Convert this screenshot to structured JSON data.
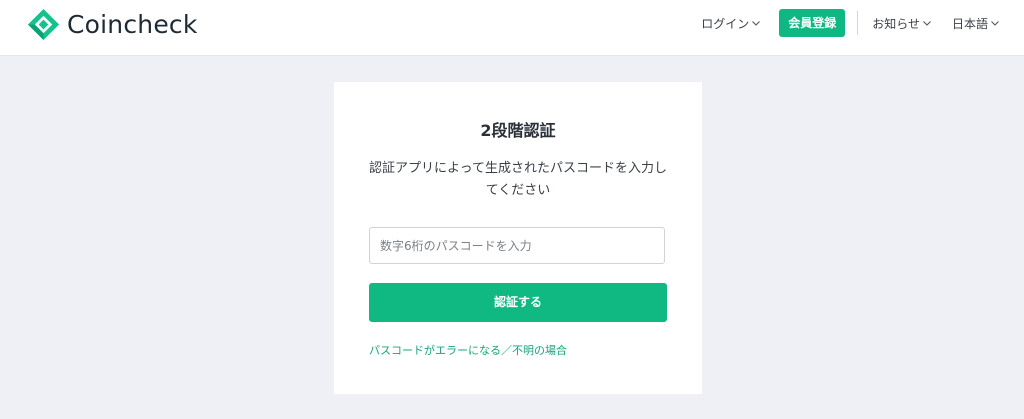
{
  "header": {
    "logo_text": "Coincheck",
    "brand_color": "#0fb882",
    "nav": {
      "login_label": "ログイン",
      "signup_label": "会員登録",
      "news_label": "お知らせ",
      "language_label": "日本語"
    }
  },
  "card": {
    "title": "2段階認証",
    "description": "認証アプリによって生成されたパスコードを入力してください",
    "input": {
      "placeholder": "数字6桁のパスコードを入力",
      "value": ""
    },
    "submit_label": "認証する",
    "help_link": "パスコードがエラーになる／不明の場合"
  },
  "icons": {
    "logo": "coincheck-diamond-logo-icon",
    "dropdown": "chevron-down-icon"
  }
}
